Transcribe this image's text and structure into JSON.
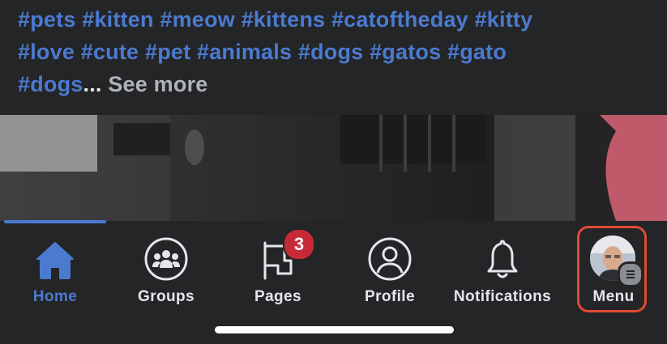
{
  "post": {
    "line1": "#pets #kitten #meow #kittens #catoftheday #kitty",
    "line2": "#love #cute #pet #animals #dogs #gatos #gato",
    "line3_tag": "#dogs",
    "ellipsis": "...",
    "see_more": " See more"
  },
  "colors": {
    "accent": "#4b7ad1",
    "background": "#242526",
    "badge": "#c62a38",
    "highlight": "#e04a33"
  },
  "tabs": [
    {
      "label": "Home",
      "icon": "home-icon",
      "active": true
    },
    {
      "label": "Groups",
      "icon": "groups-icon",
      "active": false
    },
    {
      "label": "Pages",
      "icon": "pages-flag-icon",
      "active": false,
      "badge": "3"
    },
    {
      "label": "Profile",
      "icon": "profile-icon",
      "active": false
    },
    {
      "label": "Notifications",
      "icon": "bell-icon",
      "active": false
    },
    {
      "label": "Menu",
      "icon": "avatar-menu-icon",
      "active": false
    }
  ]
}
